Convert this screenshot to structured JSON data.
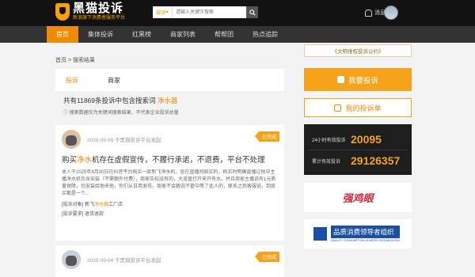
{
  "header": {
    "logo_title": "黑猫投诉",
    "logo_sub": "新浪旗下消费者服务平台",
    "search_type": "投诉",
    "search_placeholder": "请输入关键字搜索",
    "message_label": "消息"
  },
  "nav": [
    "首页",
    "集体投诉",
    "红黑榜",
    "商家列表",
    "帮帮团",
    "热点追踪"
  ],
  "breadcrumb": {
    "home": "首页",
    "sep": ">",
    "current": "搜索结果"
  },
  "search_tabs": [
    "投诉",
    "商家"
  ],
  "summary": {
    "prefix": "共有11869条投诉中包含搜索词",
    "keyword": "净水器"
  },
  "tip": "ⓘ 搜索数据仅为关键词搜索结果，不代表企业投诉总量",
  "complaints": [
    {
      "date": "2025-09-09 于黑猫投诉平台发起",
      "status": "已完成",
      "title_pre": "购买",
      "title_kw": "净水",
      "title_post": "机存在虚假宣传，不履行承诺，不退费，平台不处理",
      "body": "本人于2025年8月30日在抖音平台购买一款新飞净水机，是在直播间购买的，购买时明确直播过程中主播净水机包含安装（不需额外付费），商家告知没有的，大道盘打开来开有水，并且商家主播说有1元质量保障，包安装给他来他，你们从日用发布，商家不会跟说不管中等了此人的，联系之后客服说，到底买都是一个...",
      "target_label": "[投诉对象]",
      "target_pre": "新飞",
      "target_kw": "净水器",
      "target_post": "工厂店",
      "demand_label": "[投诉要求]",
      "demand": "退货退款"
    },
    {
      "date": "2025-09-04 于黑猫投诉平台发起",
      "status": "已完成"
    }
  ],
  "sidebar": {
    "notice": "《文明维权投诉公约》",
    "btn_complain": "我要投诉",
    "btn_mine": "我的投诉单",
    "stats": [
      {
        "label": "24小时有效投诉",
        "value": "20095"
      },
      {
        "label": "累计有效投诉",
        "value": "29126357"
      }
    ],
    "ad1_text": "强鸡眼",
    "ad2_title": "品质消费领导者组织",
    "ad2_sub": "QUALITY CONSUMPTION LEADERS ORGANIZATION"
  },
  "colors": {
    "accent": "#f08a00",
    "header_bg": "#121212",
    "nav_bg": "#333333"
  }
}
